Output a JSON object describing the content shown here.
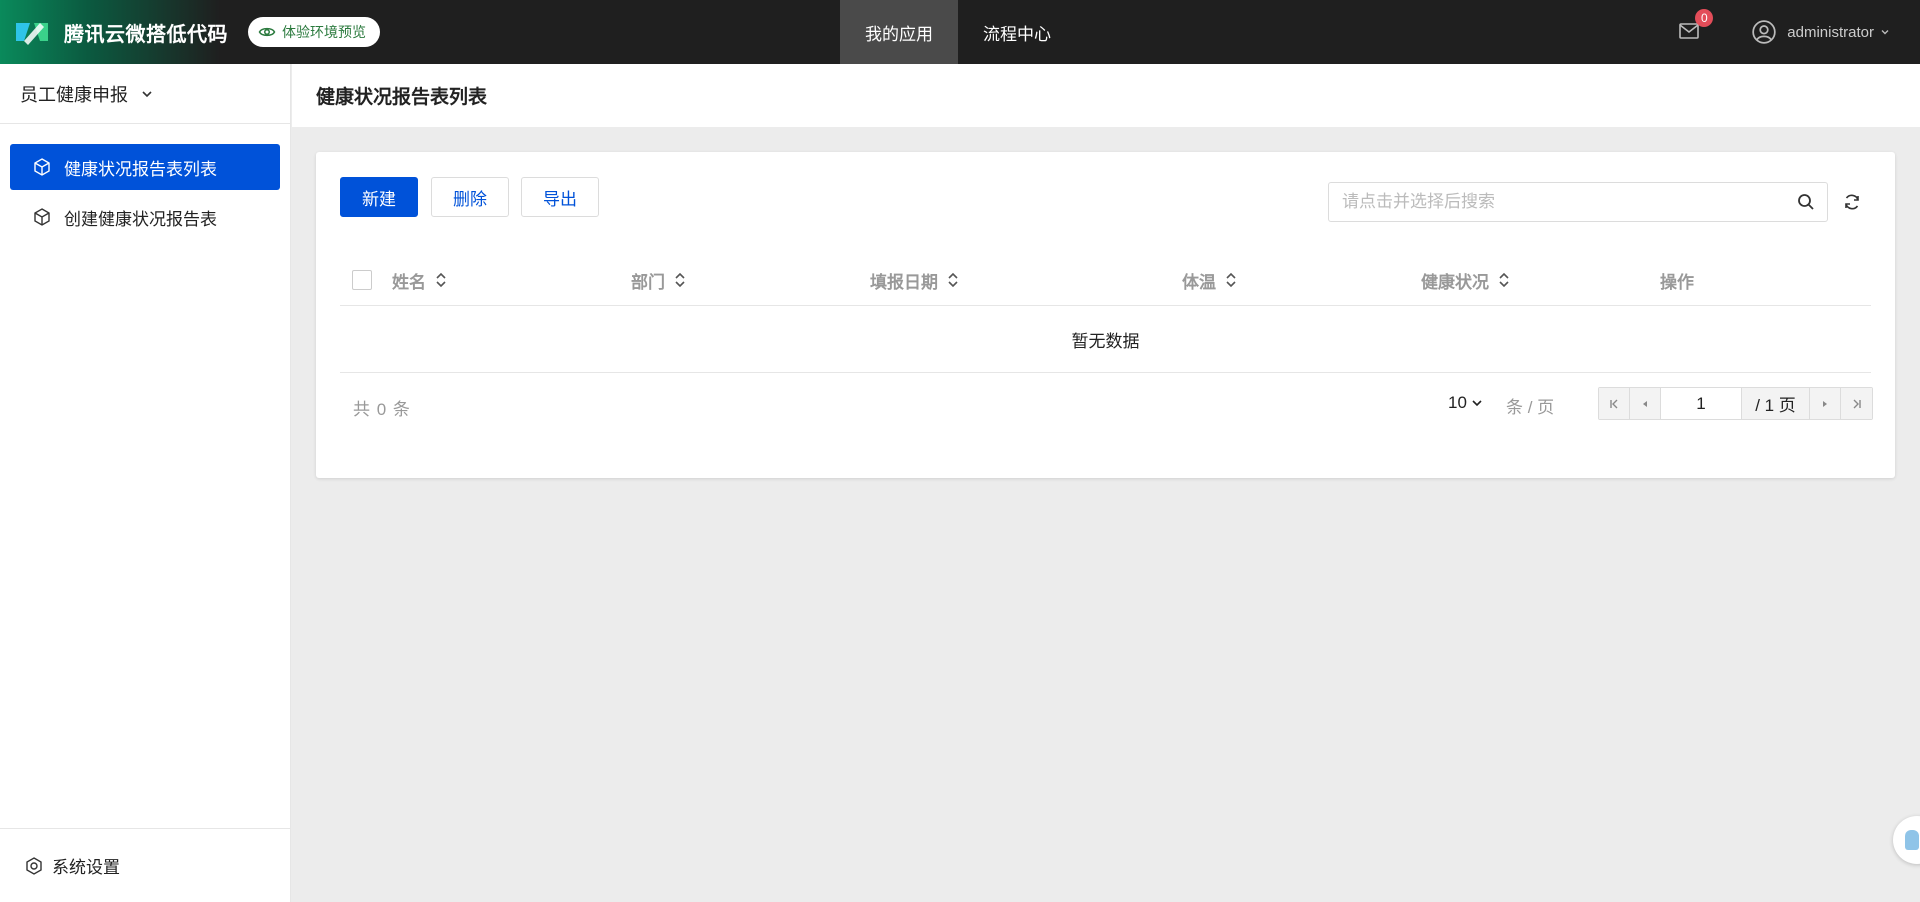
{
  "topbar": {
    "brand_title": "腾讯云微搭低代码",
    "env_badge": "体验环境预览",
    "nav": [
      "我的应用",
      "流程中心"
    ],
    "mail_count": "0",
    "user_name": "administrator"
  },
  "sidebar": {
    "app_name": "员工健康申报",
    "items": [
      {
        "label": "健康状况报告表列表"
      },
      {
        "label": "创建健康状况报告表"
      }
    ],
    "footer": "系统设置"
  },
  "page": {
    "title": "健康状况报告表列表"
  },
  "toolbar": {
    "new_label": "新建",
    "delete_label": "删除",
    "export_label": "导出",
    "search_placeholder": "请点击并选择后搜索"
  },
  "table": {
    "columns": [
      "姓名",
      "部门",
      "填报日期",
      "体温",
      "健康状况",
      "操作"
    ],
    "empty_text": "暂无数据"
  },
  "pagination": {
    "total_text": "共 0 条",
    "page_size": "10",
    "per_page_text": "条 / 页",
    "current_page": "1",
    "page_total": "/ 1 页"
  },
  "colors": {
    "primary": "#0052d9",
    "topbar": "#1f1f1f",
    "badge": "#e34d59"
  }
}
